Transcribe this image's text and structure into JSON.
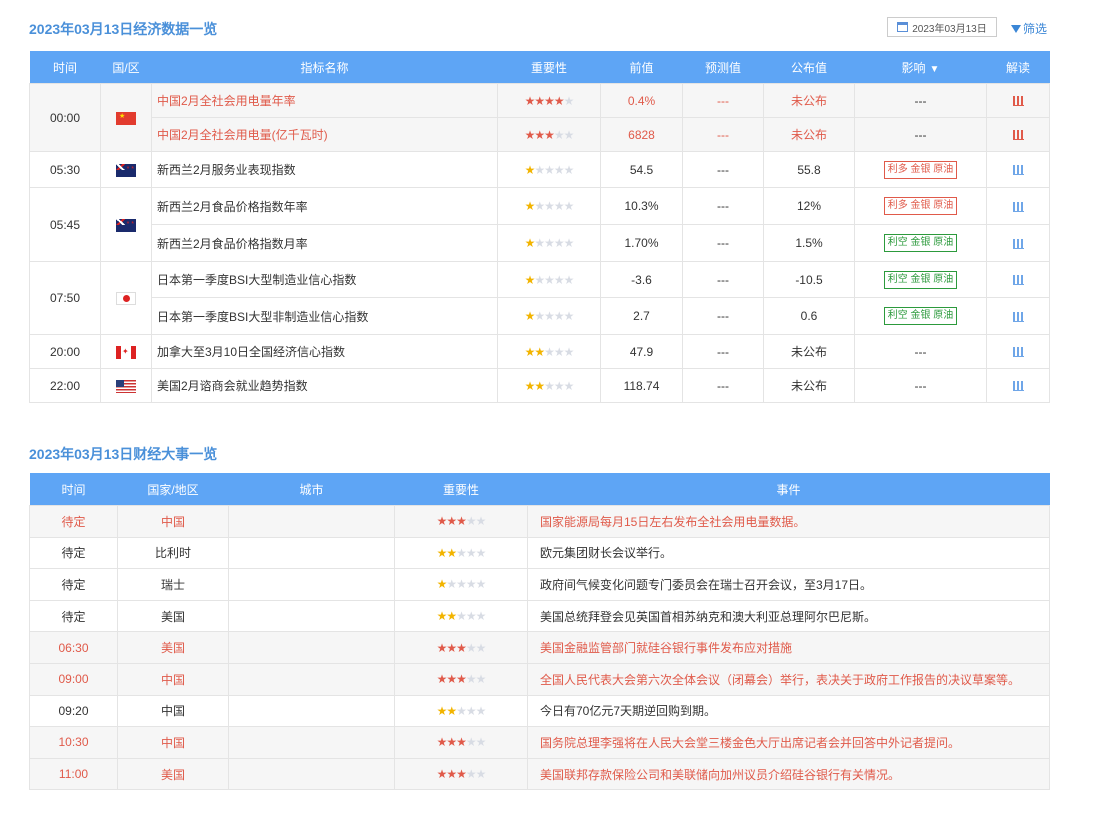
{
  "econ": {
    "title": "2023年03月13日经济数据一览",
    "date_value": "2023年03月13日",
    "filter_label": "筛选",
    "headers": {
      "time": "时间",
      "region": "国/区",
      "name": "指标名称",
      "importance": "重要性",
      "prev": "前值",
      "forecast": "预测值",
      "actual": "公布值",
      "impact": "影响",
      "analysis": "解读"
    },
    "rows": [
      {
        "time": "00:00",
        "flag": "flag-cn",
        "name": "中国2月全社会用电量年率",
        "stars": 4,
        "prev": "0.4%",
        "forecast": "---",
        "actual": "未公布",
        "impact": "---"
      },
      {
        "name": "中国2月全社会用电量(亿千瓦时)",
        "stars": 3,
        "prev": "6828",
        "forecast": "---",
        "actual": "未公布",
        "impact": "---"
      },
      {
        "time": "05:30",
        "flag": "flag-nz",
        "name": "新西兰2月服务业表现指数",
        "stars": 1,
        "prev": "54.5",
        "forecast": "---",
        "actual": "55.8",
        "impact": "利多 金银 原油"
      },
      {
        "time": "05:45",
        "flag": "flag-nz",
        "name": "新西兰2月食品价格指数年率",
        "stars": 1,
        "prev": "10.3%",
        "forecast": "---",
        "actual": "12%",
        "impact": "利多 金银 原油"
      },
      {
        "name": "新西兰2月食品价格指数月率",
        "stars": 1,
        "prev": "1.70%",
        "forecast": "---",
        "actual": "1.5%",
        "impact": "利空 金银 原油"
      },
      {
        "time": "07:50",
        "flag": "flag-jp",
        "name": "日本第一季度BSI大型制造业信心指数",
        "stars": 1,
        "prev": "-3.6",
        "forecast": "---",
        "actual": "-10.5",
        "impact": "利空 金银 原油"
      },
      {
        "name": "日本第一季度BSI大型非制造业信心指数",
        "stars": 1,
        "prev": "2.7",
        "forecast": "---",
        "actual": "0.6",
        "impact": "利空 金银 原油"
      },
      {
        "time": "20:00",
        "flag": "flag-ca",
        "name": "加拿大至3月10日全国经济信心指数",
        "stars": 2,
        "prev": "47.9",
        "forecast": "---",
        "actual": "未公布",
        "impact": "---"
      },
      {
        "time": "22:00",
        "flag": "flag-us",
        "name": "美国2月谘商会就业趋势指数",
        "stars": 2,
        "prev": "118.74",
        "forecast": "---",
        "actual": "未公布",
        "impact": "---"
      }
    ]
  },
  "events": {
    "title": "2023年03月13日财经大事一览",
    "headers": {
      "time": "时间",
      "country": "国家/地区",
      "city": "城市",
      "importance": "重要性",
      "event": "事件"
    },
    "rows": [
      {
        "time": "待定",
        "country": "中国",
        "city": "",
        "stars": 3,
        "event": "国家能源局每月15日左右发布全社会用电量数据。",
        "hot": true
      },
      {
        "time": "待定",
        "country": "比利时",
        "city": "",
        "stars": 2,
        "event": "欧元集团财长会议举行。",
        "hot": false
      },
      {
        "time": "待定",
        "country": "瑞士",
        "city": "",
        "stars": 1,
        "event": "政府间气候变化问题专门委员会在瑞士召开会议，至3月17日。",
        "hot": false
      },
      {
        "time": "待定",
        "country": "美国",
        "city": "",
        "stars": 2,
        "event": "美国总统拜登会见英国首相苏纳克和澳大利亚总理阿尔巴尼斯。",
        "hot": false
      },
      {
        "time": "06:30",
        "country": "美国",
        "city": "",
        "stars": 3,
        "event": "美国金融监管部门就硅谷银行事件发布应对措施",
        "hot": true
      },
      {
        "time": "09:00",
        "country": "中国",
        "city": "",
        "stars": 3,
        "event": "全国人民代表大会第六次全体会议（闭幕会）举行，表决关于政府工作报告的决议草案等。",
        "hot": true
      },
      {
        "time": "09:20",
        "country": "中国",
        "city": "",
        "stars": 2,
        "event": "今日有70亿元7天期逆回购到期。",
        "hot": false
      },
      {
        "time": "10:30",
        "country": "中国",
        "city": "",
        "stars": 3,
        "event": "国务院总理李强将在人民大会堂三楼金色大厅出席记者会并回答中外记者提问。",
        "hot": true
      },
      {
        "time": "11:00",
        "country": "美国",
        "city": "",
        "stars": 3,
        "event": "美国联邦存款保险公司和美联储向加州议员介绍硅谷银行有关情况。",
        "hot": true
      }
    ]
  }
}
